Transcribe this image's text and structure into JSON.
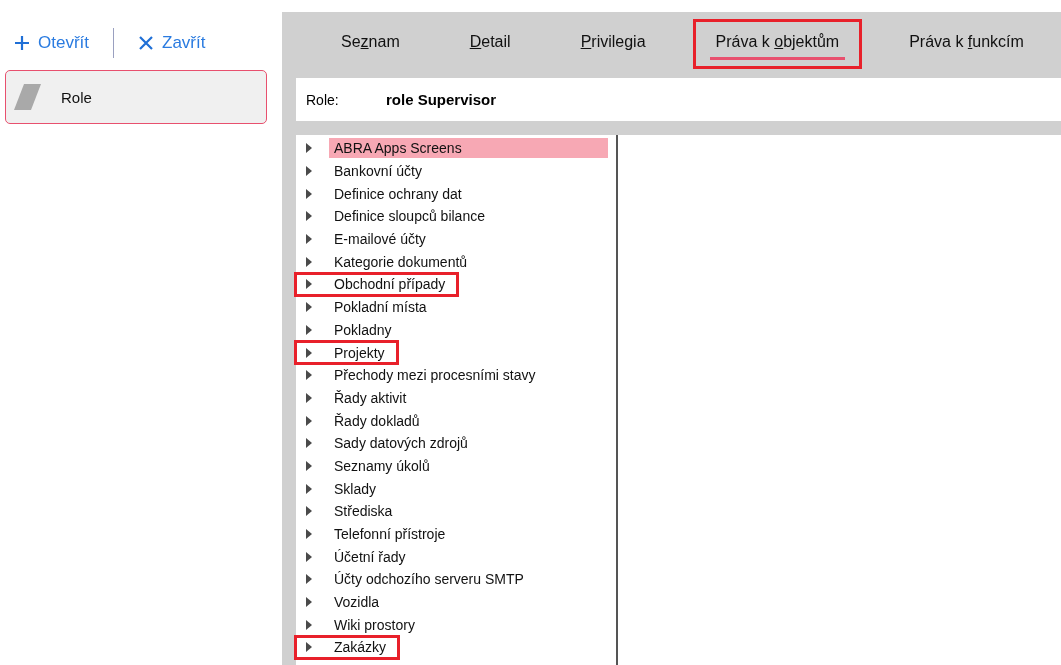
{
  "toolbar": {
    "open_label": "Otevřít",
    "close_label": "Zavřít"
  },
  "nav_items": [
    {
      "label": "Role",
      "selected": true
    }
  ],
  "tabs": [
    {
      "before": "Se",
      "key": "z",
      "after": "nam",
      "selected": false,
      "highlighted": false
    },
    {
      "key": "D",
      "after": "etail",
      "selected": false,
      "highlighted": false
    },
    {
      "key": "P",
      "after": "rivilegia",
      "selected": false,
      "highlighted": false
    },
    {
      "before": "Práva k ",
      "key": "o",
      "after": "bjektům",
      "selected": true,
      "highlighted": true
    },
    {
      "before": "Práva k ",
      "key": "f",
      "after": "unkcím",
      "selected": false,
      "highlighted": false
    }
  ],
  "role_field": {
    "label": "Role:",
    "value": "role Supervisor"
  },
  "tree": [
    {
      "label": "ABRA Apps Screens",
      "selected": true,
      "highlighted": false
    },
    {
      "label": "Bankovní účty",
      "selected": false,
      "highlighted": false
    },
    {
      "label": "Definice ochrany dat",
      "selected": false,
      "highlighted": false
    },
    {
      "label": "Definice sloupců bilance",
      "selected": false,
      "highlighted": false
    },
    {
      "label": "E-mailové účty",
      "selected": false,
      "highlighted": false
    },
    {
      "label": "Kategorie dokumentů",
      "selected": false,
      "highlighted": false
    },
    {
      "label": "Obchodní případy",
      "selected": false,
      "highlighted": true
    },
    {
      "label": "Pokladní místa",
      "selected": false,
      "highlighted": false
    },
    {
      "label": "Pokladny",
      "selected": false,
      "highlighted": false
    },
    {
      "label": "Projekty",
      "selected": false,
      "highlighted": true
    },
    {
      "label": "Přechody mezi procesními stavy",
      "selected": false,
      "highlighted": false
    },
    {
      "label": "Řady aktivit",
      "selected": false,
      "highlighted": false
    },
    {
      "label": "Řady dokladů",
      "selected": false,
      "highlighted": false
    },
    {
      "label": "Sady datových zdrojů",
      "selected": false,
      "highlighted": false
    },
    {
      "label": "Seznamy úkolů",
      "selected": false,
      "highlighted": false
    },
    {
      "label": "Sklady",
      "selected": false,
      "highlighted": false
    },
    {
      "label": "Střediska",
      "selected": false,
      "highlighted": false
    },
    {
      "label": "Telefonní přístroje",
      "selected": false,
      "highlighted": false
    },
    {
      "label": "Účetní řady",
      "selected": false,
      "highlighted": false
    },
    {
      "label": "Účty odchozího serveru SMTP",
      "selected": false,
      "highlighted": false
    },
    {
      "label": "Vozidla",
      "selected": false,
      "highlighted": false
    },
    {
      "label": "Wiki prostory",
      "selected": false,
      "highlighted": false
    },
    {
      "label": "Zakázky",
      "selected": false,
      "highlighted": true
    }
  ]
}
